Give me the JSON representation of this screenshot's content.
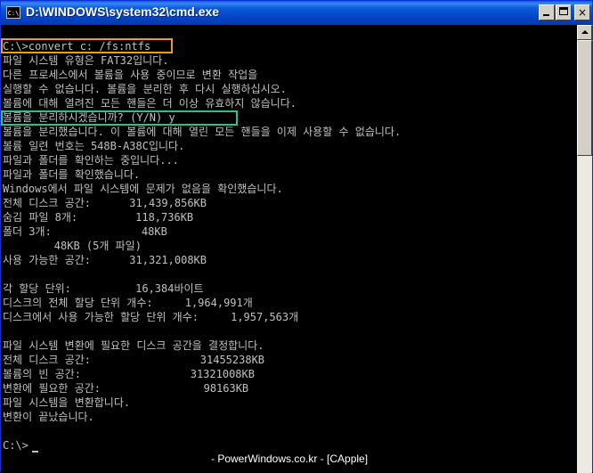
{
  "window": {
    "title": "D:\\WINDOWS\\system32\\cmd.exe",
    "icon_name": "console-app-icon",
    "icon_text": "C:\\",
    "buttons": {
      "minimize": "minimize-button",
      "maximize": "maximize-button",
      "close": "×"
    }
  },
  "console": {
    "lines": [
      "C:\\>convert c: /fs:ntfs",
      "파일 시스템 유형은 FAT32입니다.",
      "다른 프로세스에서 볼륨을 사용 중이므로 변환 작업을",
      "실행할 수 없습니다. 볼륨을 분리한 후 다시 실행하십시오.",
      "볼륨에 대해 열려진 모든 핸들은 더 이상 유효하지 않습니다.",
      "볼륨을 분리하시겠습니까? (Y/N) y",
      "볼륨을 분리했습니다. 이 볼륨에 대해 열린 모든 핸들을 이제 사용할 수 없습니다.",
      "볼륨 일련 번호는 548B-A38C입니다.",
      "파일과 폴더를 확인하는 중입니다...",
      "파일과 폴더를 확인했습니다.",
      "Windows에서 파일 시스템에 문제가 없음을 확인했습니다.",
      "전체 디스크 공간:      31,439,856KB",
      "숨김 파일 8개:         118,736KB",
      "폴더 3개:              48KB",
      "        48KB (5개 파일)",
      "사용 가능한 공간:      31,321,008KB",
      "",
      "각 할당 단위:          16,384바이트",
      "디스크의 전체 할당 단위 개수:     1,964,991개",
      "디스크에서 사용 가능한 할당 단위 개수:     1,957,563개",
      "",
      "파일 시스템 변환에 필요한 디스크 공간을 결정합니다.",
      "전체 디스크 공간:                 31455238KB",
      "볼륨의 빈 공간:                 31321008KB",
      "변환에 필요한 공간:                98163KB",
      "파일 시스템을 변환합니다.",
      "변환이 끝났습니다.",
      "",
      "C:\\>"
    ]
  },
  "watermark": "- PowerWindows.co.kr - [CApple]",
  "highlights": {
    "command": "#f29c11",
    "confirm": "#22c493"
  }
}
